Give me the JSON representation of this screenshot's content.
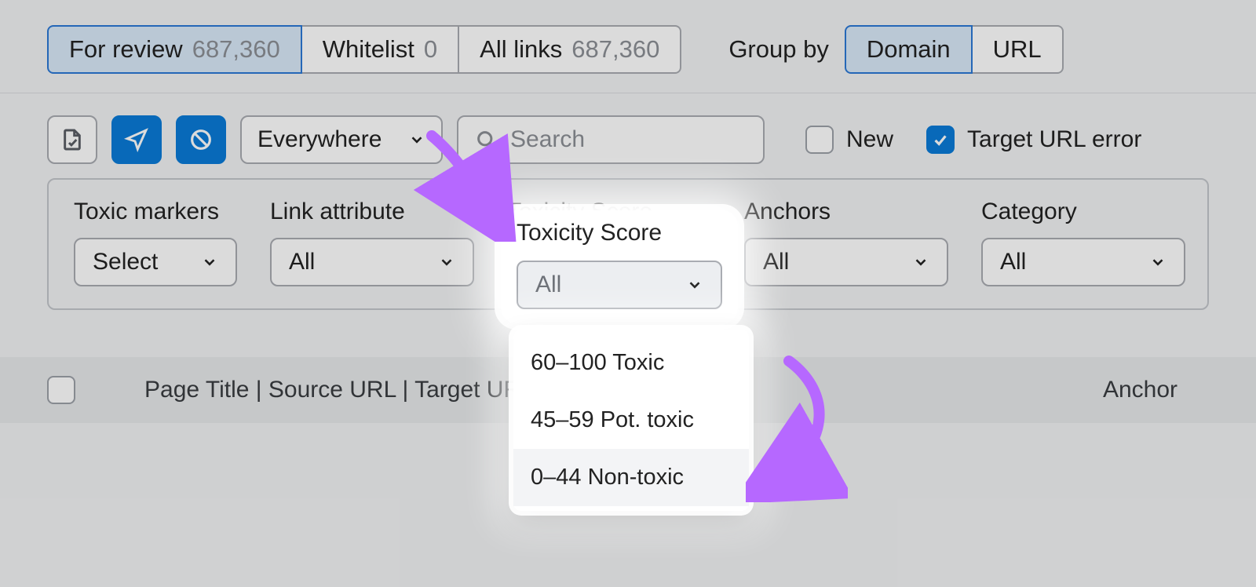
{
  "tabs": [
    {
      "label": "For review",
      "count": "687,360",
      "selected": true
    },
    {
      "label": "Whitelist",
      "count": "0",
      "selected": false
    },
    {
      "label": "All links",
      "count": "687,360",
      "selected": false
    }
  ],
  "group_by": {
    "label": "Group by",
    "options": [
      {
        "label": "Domain",
        "selected": true
      },
      {
        "label": "URL",
        "selected": false
      }
    ]
  },
  "toolbar": {
    "scope_select": "Everywhere",
    "search_placeholder": "Search",
    "new_label": "New",
    "target_url_error_label": "Target URL error",
    "new_checked": false,
    "target_url_error_checked": true
  },
  "filters": {
    "toxic_markers": {
      "label": "Toxic markers",
      "value": "Select"
    },
    "link_attribute": {
      "label": "Link attribute",
      "value": "All"
    },
    "toxicity_score": {
      "label": "Toxicity Score",
      "value": "All"
    },
    "anchors": {
      "label": "Anchors",
      "value": "All"
    },
    "category": {
      "label": "Category",
      "value": "All"
    }
  },
  "toxicity_dropdown": {
    "options": [
      "60–100 Toxic",
      "45–59 Pot. toxic",
      "0–44 Non-toxic"
    ],
    "hover_index": 2
  },
  "table": {
    "col_main": "Page Title | Source URL | Target URL",
    "col_anchor": "Anchor"
  }
}
